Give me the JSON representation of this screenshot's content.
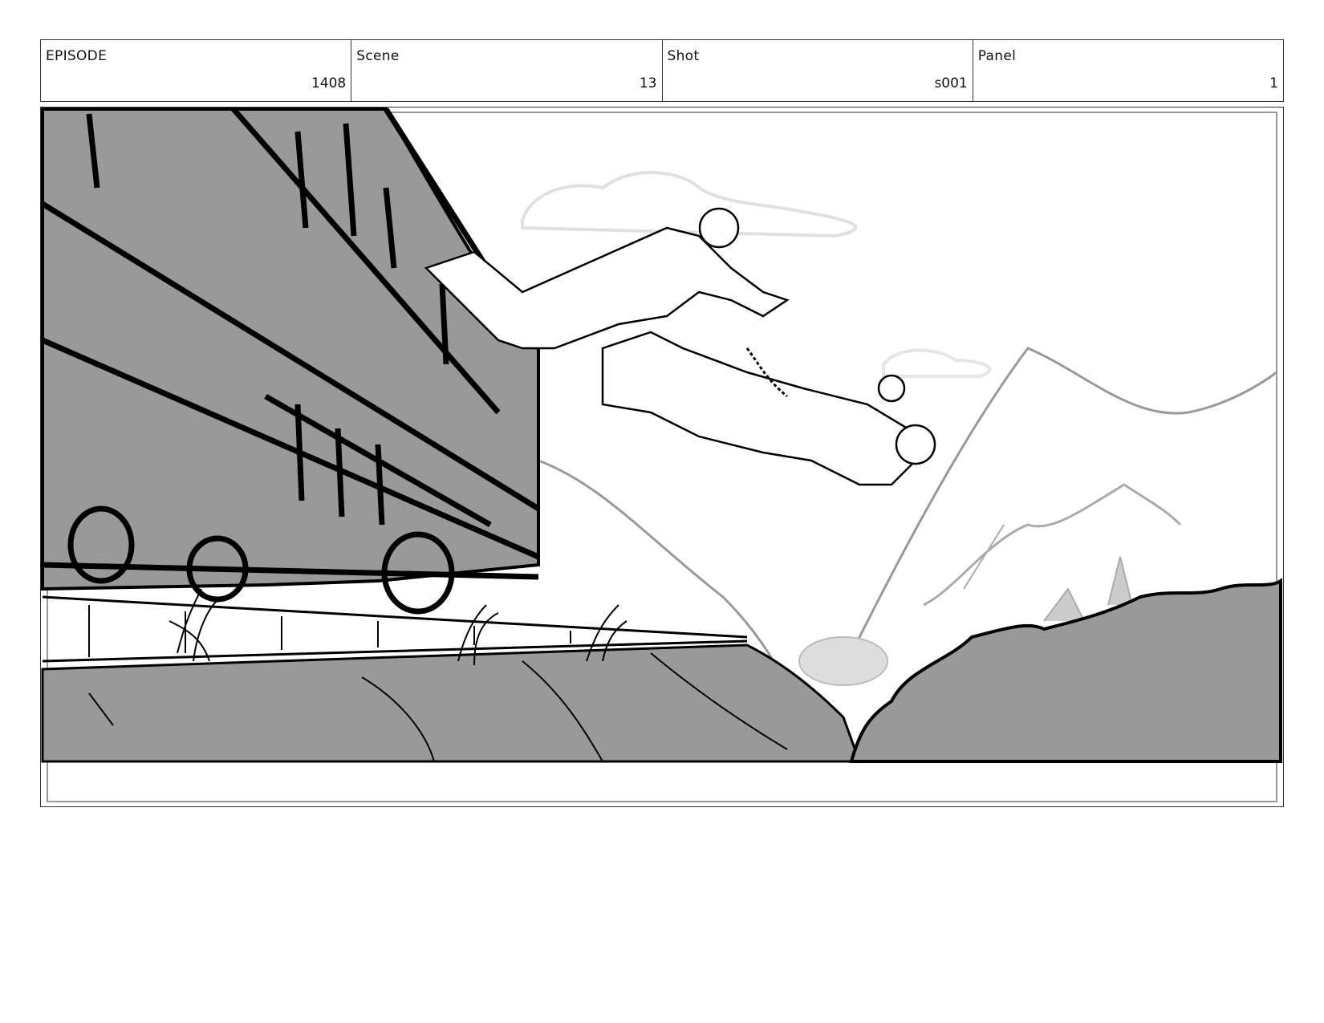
{
  "header": {
    "cells": [
      {
        "label": "EPISODE",
        "value": "1408"
      },
      {
        "label": "Scene",
        "value": "13"
      },
      {
        "label": "Shot",
        "value": "s001"
      },
      {
        "label": "Panel",
        "value": "1"
      }
    ]
  },
  "panel": {
    "illustration": "storyboard-sketch-train-jump",
    "colors": {
      "gray_fill": "#999999",
      "light_gray": "#cccccc",
      "line": "#000000",
      "background": "#ffffff"
    }
  }
}
